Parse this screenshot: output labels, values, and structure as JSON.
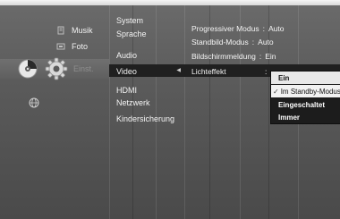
{
  "main_menu": {
    "items": [
      {
        "label": "Musik",
        "icon": "music-icon"
      },
      {
        "label": "Foto",
        "icon": "photo-icon"
      },
      {
        "label": "Einst.",
        "icon": "gear-icon"
      }
    ]
  },
  "settings_menu": {
    "items": [
      {
        "label": "System"
      },
      {
        "label": "Sprache"
      },
      {
        "label": "Audio"
      },
      {
        "label": "Video"
      },
      {
        "label": "HDMI"
      },
      {
        "label": "Netzwerk"
      },
      {
        "label": "Kindersicherung"
      }
    ],
    "selected": "Video"
  },
  "video_options": {
    "rows": [
      {
        "label": "Progressiver Modus",
        "value": "Auto"
      },
      {
        "label": "Standbild-Modus",
        "value": "Auto"
      },
      {
        "label": "Bildschirmmeldung",
        "value": "Ein"
      },
      {
        "label": "Lichteffekt",
        "value": ""
      }
    ],
    "separator": ":"
  },
  "lichteffekt_popup": {
    "options": [
      "Ein",
      "Im Standby-Modus",
      "Eingeschaltet",
      "Immer"
    ],
    "checked": "Im Standby-Modus"
  },
  "colors": {
    "panel_bg": "#5e5e5e",
    "selected_bg": "#202020",
    "popup_bg": "#1c1c1c",
    "popup_highlight": "#f2f2f2"
  }
}
